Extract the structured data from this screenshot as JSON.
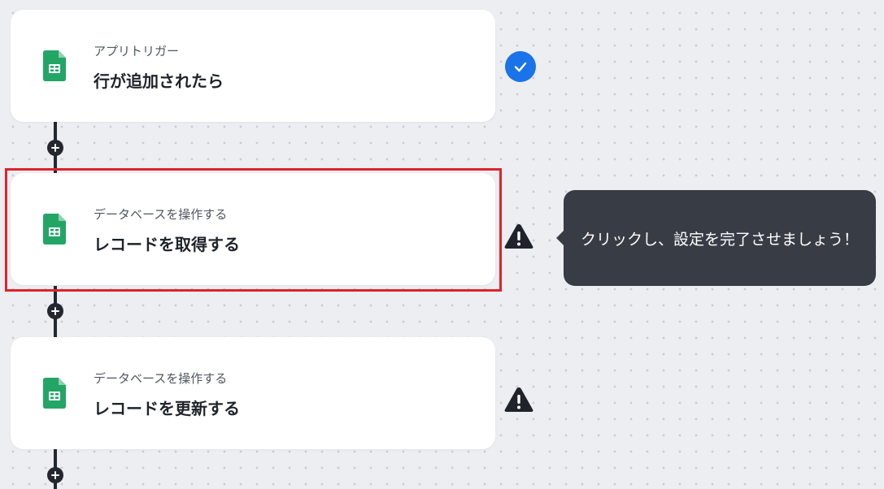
{
  "flow": {
    "steps": [
      {
        "subtitle": "アプリトリガー",
        "title": "行が追加されたら",
        "icon": "google-sheets-icon",
        "status": "complete"
      },
      {
        "subtitle": "データベースを操作する",
        "title": "レコードを取得する",
        "icon": "google-sheets-icon",
        "status": "warning"
      },
      {
        "subtitle": "データベースを操作する",
        "title": "レコードを更新する",
        "icon": "google-sheets-icon",
        "status": "warning"
      }
    ]
  },
  "tooltip": {
    "text": "クリックし、設定を完了させましょう！"
  },
  "colors": {
    "canvas_background": "#eceef2",
    "canvas_dot": "#c9cdd4",
    "connector": "#23272f",
    "card_background": "#ffffff",
    "highlight_border": "#e0232b",
    "complete_badge": "#1a73e8",
    "warning_icon": "#1f232a",
    "tooltip_background": "#383c45",
    "sheets_green": "#23a566"
  }
}
